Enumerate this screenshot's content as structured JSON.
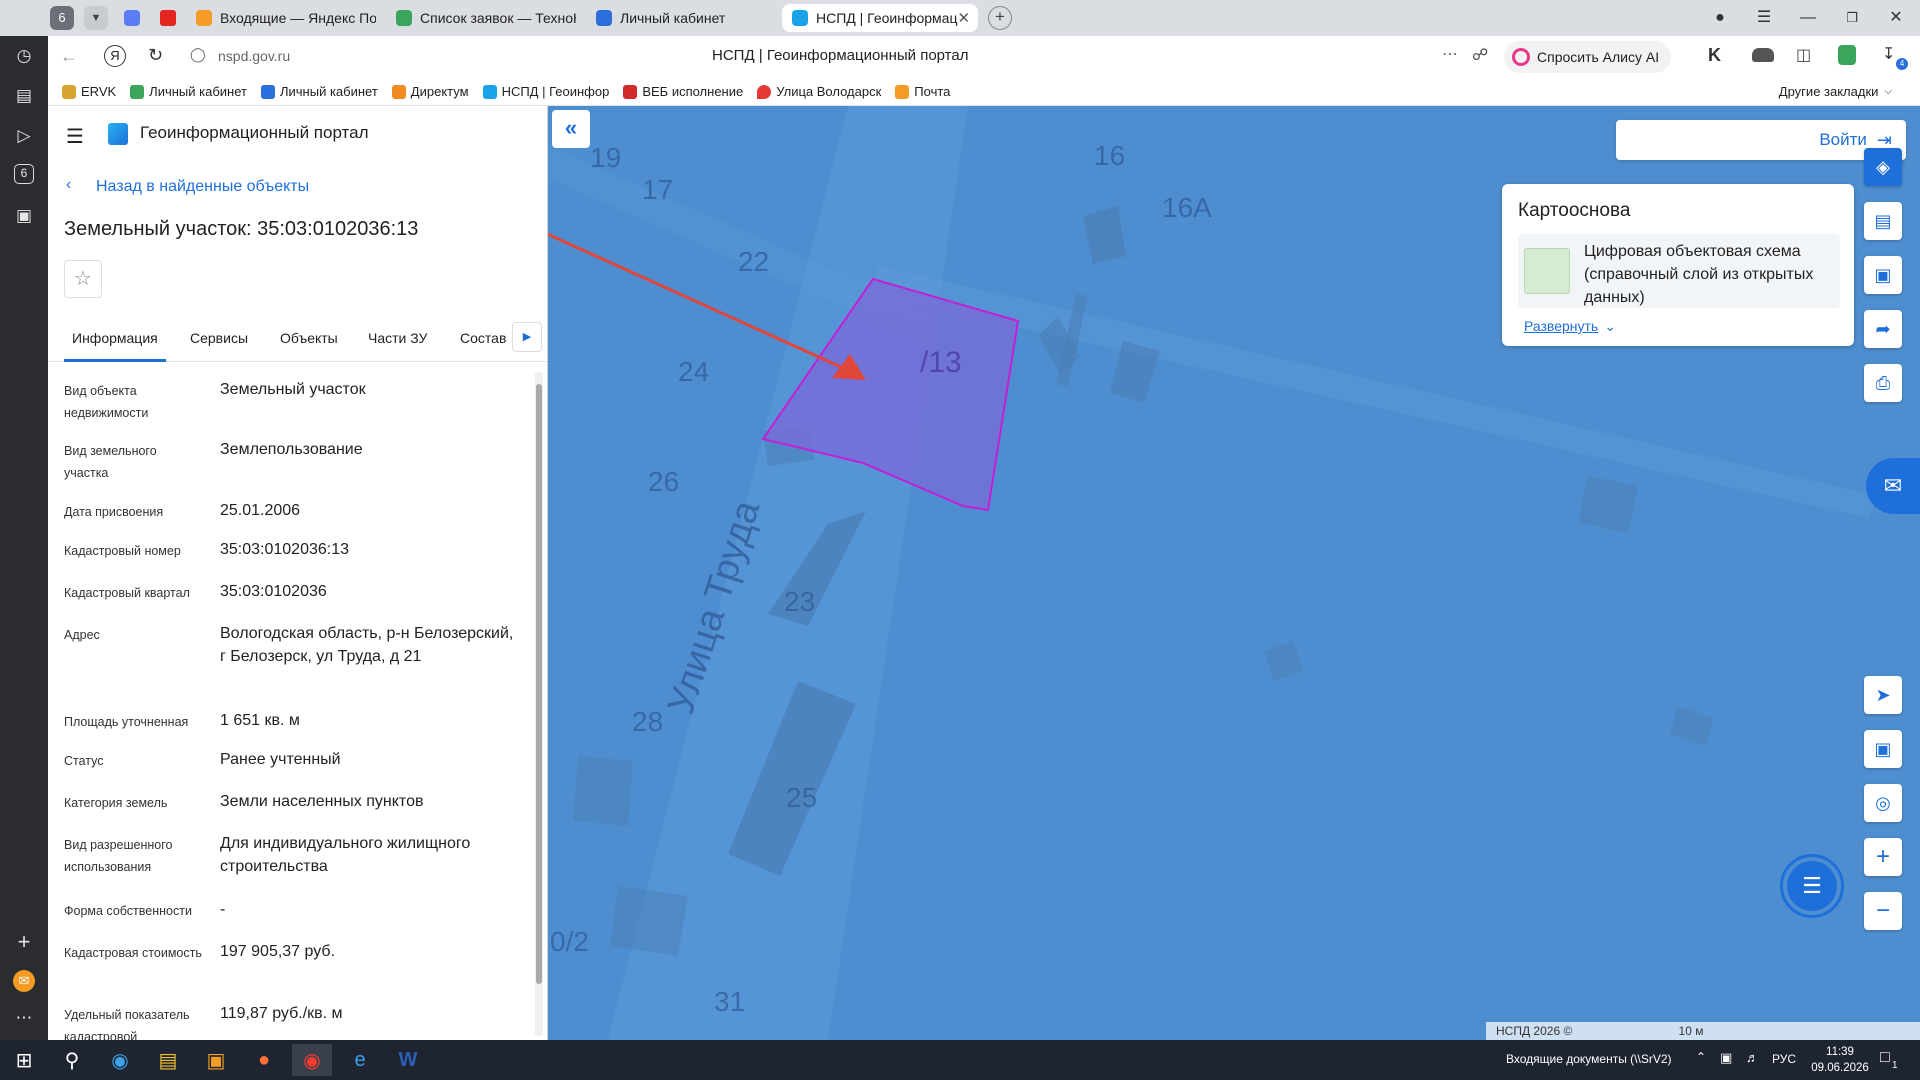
{
  "browser": {
    "profile_badge": "6",
    "tabs": [
      {
        "label": "Входящие — Яндекс Почта",
        "active": false
      },
      {
        "label": "Список заявок — ТехноК",
        "active": false
      },
      {
        "label": "Личный кабинет",
        "active": false
      },
      {
        "label": "НСПД | Геоинформационный портал",
        "active": true
      }
    ],
    "tab_labels_visible": [
      "Входящие — Яндекс Поч",
      "Список заявок — ТехноК",
      "Личный кабинет",
      "НСПД | Геоинформац"
    ],
    "url": "nspd.gov.ru",
    "page_title": "НСПД | Геоинформационный портал",
    "alice_button": "Спросить Алису AI",
    "bookmarks": [
      "ERVK",
      "Личный кабинет",
      "Личный кабинет",
      "Директум",
      "НСПД | Геоинфор",
      "ВЕБ исполнение",
      "Улица Володарск",
      "Почта"
    ],
    "other_bookmarks": "Другие закладки",
    "side_badge": "6",
    "download_badge": "4"
  },
  "panel": {
    "app_title": "Геоинформационный портал",
    "back_link": "Назад в найденные объекты",
    "object_title": "Земельный участок: 35:03:0102036:13",
    "tabs": [
      "Информация",
      "Сервисы",
      "Объекты",
      "Части ЗУ",
      "Состав"
    ],
    "active_tab": "Информация",
    "rows": [
      {
        "label": "Вид объекта недвижимости",
        "value": "Земельный участок"
      },
      {
        "label": "Вид земельного участка",
        "value": "Землепользование"
      },
      {
        "label": "Дата присвоения",
        "value": "25.01.2006"
      },
      {
        "label": "Кадастровый номер",
        "value": "35:03:0102036:13"
      },
      {
        "label": "Кадастровый квартал",
        "value": "35:03:0102036"
      },
      {
        "label": "Адрес",
        "value": "Вологодская область, р-н Белозерский, г Белозерск, ул Труда, д 21"
      },
      {
        "label": "Площадь уточненная",
        "value": "1 651 кв. м"
      },
      {
        "label": "Статус",
        "value": "Ранее учтенный"
      },
      {
        "label": "Категория земель",
        "value": "Земли населенных пунктов"
      },
      {
        "label": "Вид разрешенного использования",
        "value": "Для индивидуального жилищного строительства"
      },
      {
        "label": "Форма собственности",
        "value": "-"
      },
      {
        "label": "Кадастровая стоимость",
        "value": "197 905,37 руб."
      },
      {
        "label": "Удельный показатель кадастровой",
        "value": "119,87 руб./кв. м"
      }
    ]
  },
  "map": {
    "login_button": "Войти",
    "basemap_title": "Картооснова",
    "basemap_layer": "Цифровая объектовая схема (справочный слой из открытых данных)",
    "expand_link": "Развернуть",
    "street_label": "Улица Труда",
    "parcel_label": "/13",
    "house_numbers": [
      "19",
      "17",
      "16",
      "16А",
      "22",
      "24",
      "26",
      "23",
      "28",
      "25",
      "0/2",
      "31"
    ],
    "copyright": "НСПД 2026 ©",
    "scale": "10 м",
    "colors": {
      "map_bg": "#4e8ed0",
      "parcel_fill": "#7a6ad8",
      "parcel_border": "#c21fd6",
      "arrow": "#e0463a",
      "accent": "#1e6fd9"
    }
  },
  "taskbar": {
    "notification": "Входящие документы (\\\\SrV2)",
    "language": "РУС",
    "time": "11:39",
    "date": "09.06.2026",
    "action_badge": "1"
  }
}
